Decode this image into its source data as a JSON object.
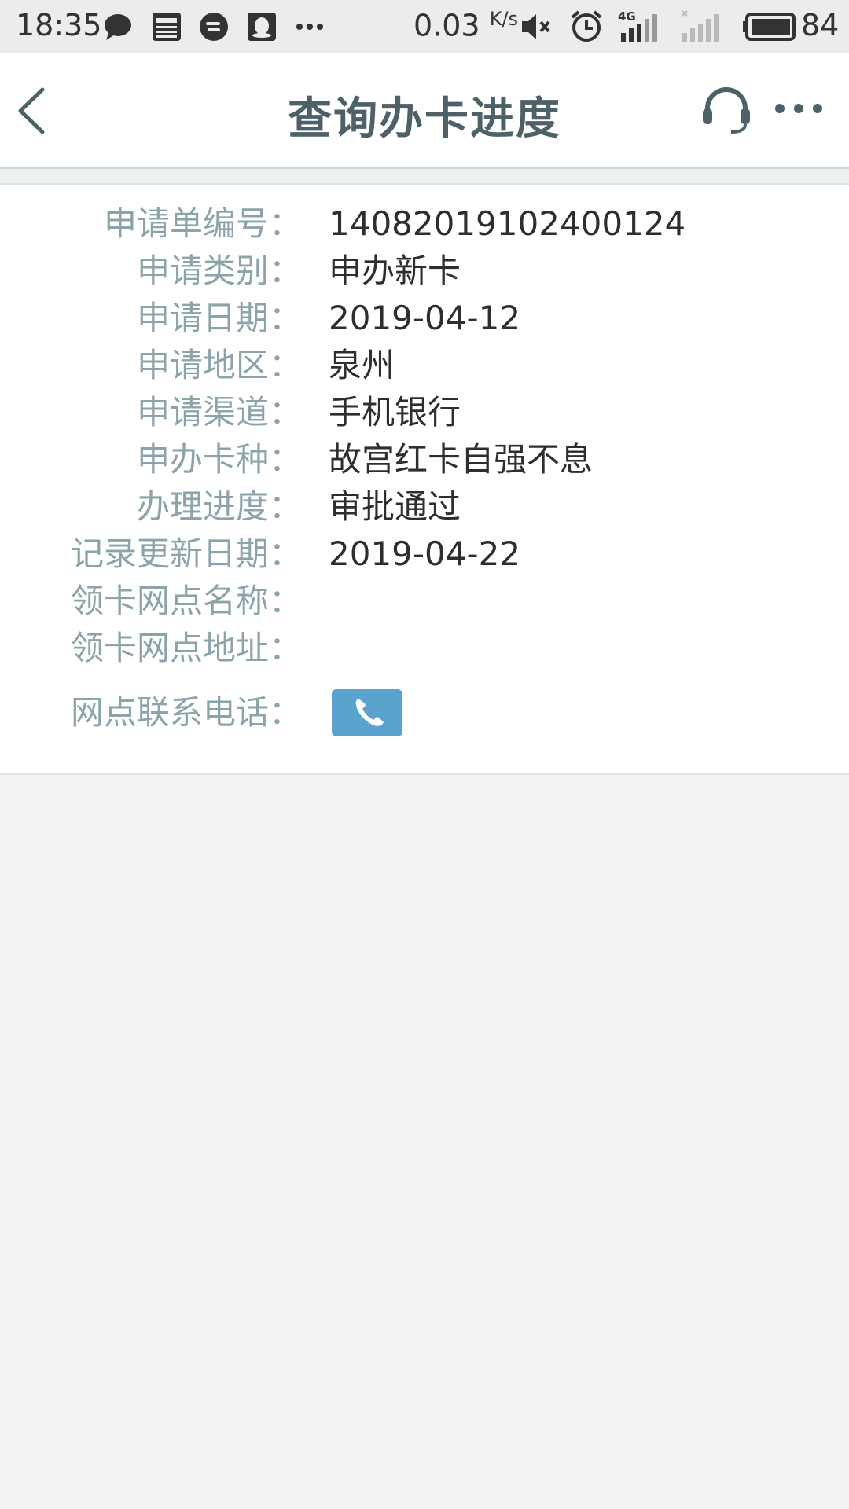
{
  "status_bar": {
    "time": "18:35",
    "network_speed": "0.03",
    "network_unit": "K/s",
    "network_tech": "4G",
    "battery_level": "84",
    "icons": [
      "chat-icon",
      "news-icon",
      "message-icon",
      "qq-icon",
      "more-dots-icon",
      "mute-icon",
      "alarm-icon",
      "signal-icon",
      "signal-off-icon",
      "battery-icon"
    ]
  },
  "nav": {
    "title": "查询办卡进度",
    "back_icon": "chevron-left-icon",
    "service_icon": "headset-icon",
    "more_icon": "more-dots-icon"
  },
  "detail": {
    "rows": [
      {
        "label": "申请单编号：",
        "value": "14082019102400124"
      },
      {
        "label": "申请类别：",
        "value": "申办新卡"
      },
      {
        "label": "申请日期：",
        "value": "2019-04-12"
      },
      {
        "label": "申请地区：",
        "value": "泉州"
      },
      {
        "label": "申请渠道：",
        "value": "手机银行"
      },
      {
        "label": "申办卡种：",
        "value": "故宫红卡自强不息"
      },
      {
        "label": "办理进度：",
        "value": "审批通过"
      },
      {
        "label": "记录更新日期：",
        "value": "2019-04-22"
      },
      {
        "label": "领卡网点名称：",
        "value": ""
      },
      {
        "label": "领卡网点地址：",
        "value": ""
      }
    ],
    "phone_label": "网点联系电话：",
    "phone_icon": "phone-icon"
  },
  "colors": {
    "label": "#8aa4aa",
    "value": "#2e2e2e",
    "title": "#4e6068",
    "phone_button": "#5aa3cf",
    "background": "#f2f2f2"
  }
}
